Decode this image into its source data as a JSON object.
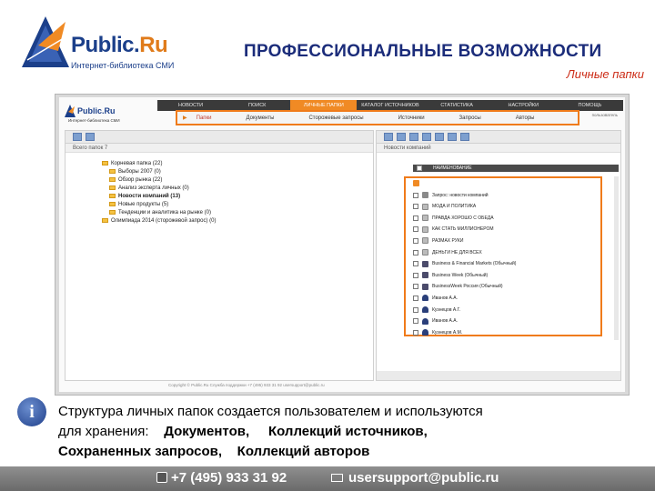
{
  "logo": {
    "title_main": "Public.",
    "title_ru": "Ru",
    "subtitle": "Интернет-библиотека СМИ"
  },
  "header": {
    "title": "ПРОФЕССИОНАЛЬНЫЕ ВОЗМОЖНОСТИ",
    "subtitle": "Личные папки"
  },
  "app": {
    "mini_logo_title": "Public.Ru",
    "mini_logo_sub": "Интернет-библиотека СМИ",
    "top_nav": [
      "НОВОСТИ",
      "ПОИСК",
      "ЛИЧНЫЕ ПАПКИ",
      "КАТАЛОГ ИСТОЧНИКОВ",
      "СТАТИСТИКА",
      "НАСТРОЙКИ",
      "ПОМОЩЬ"
    ],
    "top_nav_active": 2,
    "right_top_text": "пользователь",
    "sub_nav": [
      "Папки",
      "Документы",
      "Сторожевые запросы",
      "Источники",
      "Запросы",
      "Авторы"
    ],
    "left_header": "Всего папок 7",
    "tree": [
      {
        "label": "Корневая папка (22)",
        "level": 0,
        "bold": false
      },
      {
        "label": "Выборы 2007 (0)",
        "level": 1,
        "bold": false
      },
      {
        "label": "Обзор рынка (22)",
        "level": 1,
        "bold": false
      },
      {
        "label": "Анализ эксперта личных (0)",
        "level": 1,
        "bold": false
      },
      {
        "label": "Новости компаний (13)",
        "level": 1,
        "bold": true
      },
      {
        "label": "Новые продукты (5)",
        "level": 1,
        "bold": false
      },
      {
        "label": "Тенденции и аналитика на рынке (0)",
        "level": 1,
        "bold": false
      },
      {
        "label": "Олимпиада 2014 (сторожевой запрос) (0)",
        "level": 0,
        "bold": false
      }
    ],
    "right_header": "Новости компаний",
    "list_column": "НАИМЕНОВАНИЕ",
    "list_rows": [
      {
        "icon": "query",
        "label": "Запрос: новости компаний"
      },
      {
        "icon": "doc",
        "label": "МОДА И ПОЛИТИКА"
      },
      {
        "icon": "doc",
        "label": "ПРАВДА ХОРОШО С ОБЕДА"
      },
      {
        "icon": "doc",
        "label": "КАК СТАТЬ МИЛЛИОНЕРОМ"
      },
      {
        "icon": "doc",
        "label": "РАЗМАХ РУКИ"
      },
      {
        "icon": "doc",
        "label": "ДЕНЬГИ НЕ ДЛЯ ВСЕХ"
      },
      {
        "icon": "book",
        "label": "Business & Financial Markets (Обычный)"
      },
      {
        "icon": "book",
        "label": "Business Week (Обычный)"
      },
      {
        "icon": "book",
        "label": "BusinessWeek Россия (Обычный)"
      },
      {
        "icon": "user",
        "label": "Иванов А.А."
      },
      {
        "icon": "user",
        "label": "Кузнецов А.Г."
      },
      {
        "icon": "user",
        "label": "Иванов А.А."
      },
      {
        "icon": "user",
        "label": "Кузнецов А.М."
      }
    ],
    "status_text": "Copyright © Public.Ru   Служба поддержки +7 (495) 933 31 92   usersupport@public.ru"
  },
  "info": {
    "line1": "Структура личных папок создается пользователем и используются",
    "line2_prefix": "для хранения:",
    "line2_b1": "Документов,",
    "line2_b2": "Коллекций источников,",
    "line3_b1": "Сохраненных запросов,",
    "line3_b2": "Коллекций авторов"
  },
  "footer": {
    "phone": "+7 (495) 933 31 92",
    "email": "usersupport@public.ru"
  },
  "colors": {
    "accent_orange": "#f07b1a",
    "title_blue": "#1b2c7a",
    "subtitle_red": "#cc2c17"
  }
}
